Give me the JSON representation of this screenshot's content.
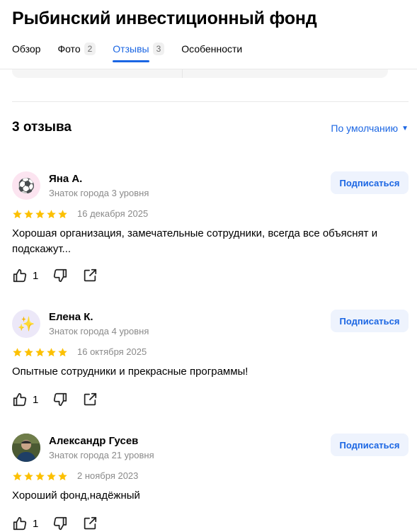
{
  "header": {
    "title": "Рыбинский инвестиционный фонд",
    "tabs": [
      {
        "label": "Обзор",
        "count": ""
      },
      {
        "label": "Фото",
        "count": "2"
      },
      {
        "label": "Отзывы",
        "count": "3"
      },
      {
        "label": "Особенности",
        "count": ""
      }
    ],
    "active_tab": "Отзывы"
  },
  "reviews_section": {
    "heading": "3 отзыва",
    "sort_label": "По умолчанию",
    "subscribe_label": "Подписаться",
    "items": [
      {
        "author": "Яна А.",
        "level": "Знаток города 3 уровня",
        "avatar": "⚽",
        "rating": 5,
        "date": "16 декабря 2025",
        "text": "Хорошая организация, замечательные сотрудники, всегда все объяснят и подскажут...",
        "likes": "1"
      },
      {
        "author": "Елена К.",
        "level": "Знаток города 4 уровня",
        "avatar": "✨",
        "rating": 5,
        "date": "16 октября 2025",
        "text": "Опытные сотрудники и прекрасные программы!",
        "likes": "1"
      },
      {
        "author": "Александр Гусев",
        "level": "Знаток города 21 уровня",
        "avatar": "",
        "rating": 5,
        "date": "2 ноября 2023",
        "text": "Хороший фонд,надёжный",
        "likes": "1"
      }
    ]
  },
  "colors": {
    "accent": "#1b66e3",
    "star": "#fcc000",
    "muted": "#8a8a8a"
  }
}
